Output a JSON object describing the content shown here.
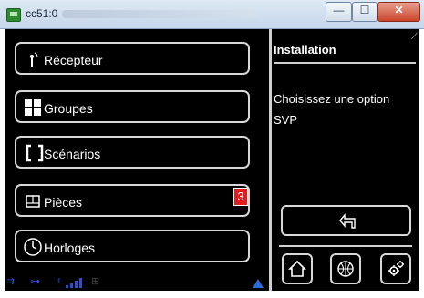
{
  "window": {
    "title": "cc51:0"
  },
  "menu": [
    {
      "label": "Récepteur",
      "icon": "receiver-icon"
    },
    {
      "label": "Groupes",
      "icon": "groups-icon"
    },
    {
      "label": "Scénarios",
      "icon": "scenarios-icon"
    },
    {
      "label": "Pièces",
      "icon": "rooms-icon",
      "badge": "3"
    },
    {
      "label": "Horloges",
      "icon": "clock-icon"
    }
  ],
  "panel": {
    "heading": "Installation",
    "message": "Choisissez une option SVP"
  },
  "colors": {
    "badge": "#e21c1c",
    "status": "#2b4fd1"
  }
}
